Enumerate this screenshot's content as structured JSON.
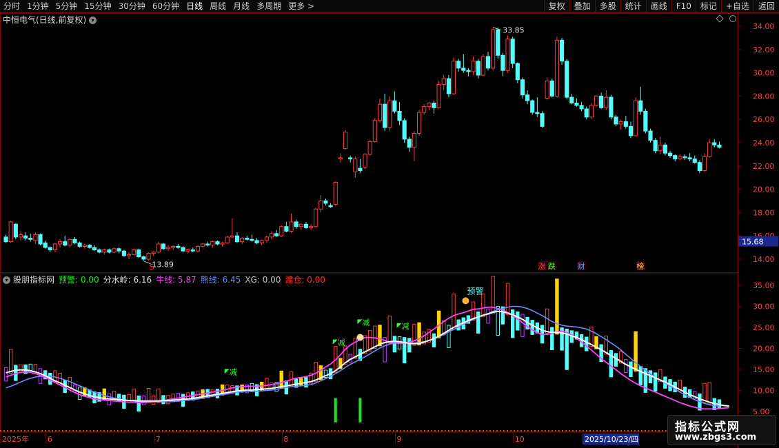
{
  "toolbar": {
    "periods": [
      "分时",
      "1分钟",
      "5分钟",
      "15分钟",
      "30分钟",
      "60分钟",
      "日线",
      "周线",
      "月线",
      "多周期"
    ],
    "active_period": "日线",
    "more": "更多 >",
    "right_buttons": [
      "复权",
      "叠加",
      "多股",
      "统计",
      "画线",
      "F10",
      "标记",
      "+自选",
      "返回"
    ]
  },
  "main_panel": {
    "stock_title": "中恒电气(日线,前复权)",
    "y_ticks": [
      "34.00",
      "32.00",
      "30.00",
      "28.00",
      "26.00",
      "24.00",
      "22.00",
      "20.00",
      "18.00",
      "16.00",
      "14.00"
    ],
    "current_price": "15.68",
    "high_annotation": "33.85",
    "low_annotation": "13.89",
    "event_tags": [
      {
        "text": "S",
        "color": "#ff3030",
        "bar": 30
      },
      {
        "text": "涨",
        "color": "#ff4040",
        "bar": 109
      },
      {
        "text": "跌",
        "color": "#30ff30",
        "bar": 111
      },
      {
        "text": "财",
        "color": "#4aa0ff",
        "bar": 117
      },
      {
        "text": "榜",
        "color": "#ffd040",
        "bar": 129
      }
    ]
  },
  "indicator_panel": {
    "name": "股朋指标网",
    "items": [
      {
        "label": "预警: 0.00",
        "color": "#00ff00"
      },
      {
        "label": "分水岭: 6.16",
        "color": "#e0e0e0"
      },
      {
        "label": "牛线: 5.87",
        "color": "#ff40ff"
      },
      {
        "label": "熊线: 6.45",
        "color": "#6a8cff"
      },
      {
        "label": "XG: 0.00",
        "color": "#c8c8c8"
      },
      {
        "label": "建仓: 0.00",
        "color": "#ff3030"
      }
    ],
    "y_ticks": [
      "35.00",
      "30.00",
      "25.00",
      "20.00",
      "15.00",
      "10.00",
      "5.00"
    ],
    "signal_labels": [
      {
        "text": "减",
        "bar": 45
      },
      {
        "text": "减",
        "bar": 67
      },
      {
        "text": "减",
        "bar": 72
      },
      {
        "text": "减",
        "bar": 80
      }
    ],
    "warning_label": "预警"
  },
  "time_axis": {
    "labels": [
      {
        "text": "2025年",
        "bar": 0
      },
      {
        "text": "6",
        "bar": 9
      },
      {
        "text": "7",
        "bar": 31
      },
      {
        "text": "8",
        "bar": 57
      },
      {
        "text": "9",
        "bar": 80
      },
      {
        "text": "10",
        "bar": 104
      }
    ],
    "cursor_date": "2025/10/23/四"
  },
  "colors": {
    "up": "#ff3b3b",
    "down": "#54fcfc",
    "frame": "#8b0000",
    "ma_white": "#ffffff",
    "bull_line": "#ff40ff",
    "bear_line": "#6a8cff"
  },
  "watermark": {
    "title": "指标公式网",
    "url": "www.zbgs3.com"
  },
  "chart_data": {
    "type": "candlestick",
    "ylim": [
      13.0,
      35.0
    ],
    "ohlc": [
      [
        15.9,
        16.1,
        15.4,
        15.5
      ],
      [
        15.5,
        17.3,
        15.4,
        17.2
      ],
      [
        17.0,
        17.1,
        15.7,
        15.9
      ],
      [
        15.9,
        16.4,
        15.6,
        16.1
      ],
      [
        16.0,
        16.3,
        15.6,
        15.8
      ],
      [
        15.8,
        16.2,
        15.5,
        15.7
      ],
      [
        15.6,
        16.3,
        15.3,
        16.1
      ],
      [
        16.1,
        16.2,
        15.2,
        15.3
      ],
      [
        15.4,
        15.6,
        14.9,
        15.0
      ],
      [
        15.0,
        15.1,
        14.6,
        14.8
      ],
      [
        14.8,
        15.4,
        14.6,
        15.3
      ],
      [
        15.3,
        15.7,
        15.0,
        15.5
      ],
      [
        15.5,
        16.0,
        15.1,
        15.2
      ],
      [
        15.2,
        15.8,
        15.0,
        15.7
      ],
      [
        15.7,
        15.9,
        15.3,
        15.4
      ],
      [
        15.4,
        15.5,
        15.0,
        15.1
      ],
      [
        15.1,
        15.3,
        14.9,
        15.2
      ],
      [
        15.2,
        15.3,
        14.9,
        15.0
      ],
      [
        15.0,
        15.2,
        14.7,
        14.8
      ],
      [
        14.8,
        14.9,
        14.5,
        14.6
      ],
      [
        14.6,
        14.9,
        14.4,
        14.8
      ],
      [
        14.8,
        14.9,
        14.5,
        14.6
      ],
      [
        14.6,
        15.0,
        14.5,
        14.9
      ],
      [
        14.9,
        15.0,
        14.5,
        14.7
      ],
      [
        14.7,
        14.8,
        14.2,
        14.3
      ],
      [
        14.3,
        14.6,
        14.0,
        14.4
      ],
      [
        14.4,
        14.9,
        14.3,
        14.8
      ],
      [
        14.8,
        14.9,
        14.1,
        14.2
      ],
      [
        14.2,
        14.3,
        13.9,
        14.0
      ],
      [
        14.0,
        14.6,
        13.9,
        14.5
      ],
      [
        14.5,
        14.7,
        14.3,
        14.6
      ],
      [
        14.6,
        15.5,
        14.5,
        15.3
      ],
      [
        15.3,
        15.4,
        14.8,
        14.9
      ],
      [
        14.9,
        15.2,
        14.7,
        15.0
      ],
      [
        15.0,
        15.2,
        14.8,
        15.1
      ],
      [
        15.1,
        15.3,
        14.9,
        15.0
      ],
      [
        15.0,
        15.1,
        14.6,
        14.7
      ],
      [
        14.7,
        14.9,
        14.5,
        14.8
      ],
      [
        14.8,
        15.0,
        14.6,
        14.7
      ],
      [
        14.7,
        15.2,
        14.6,
        15.1
      ],
      [
        15.1,
        15.4,
        15.0,
        15.3
      ],
      [
        15.3,
        15.5,
        15.1,
        15.2
      ],
      [
        15.2,
        15.6,
        15.0,
        15.5
      ],
      [
        15.5,
        15.6,
        15.2,
        15.3
      ],
      [
        15.3,
        15.5,
        15.1,
        15.4
      ],
      [
        15.4,
        16.0,
        15.3,
        15.9
      ],
      [
        15.9,
        17.5,
        15.8,
        16.0
      ],
      [
        16.0,
        16.3,
        15.4,
        15.5
      ],
      [
        15.5,
        15.9,
        15.3,
        15.8
      ],
      [
        15.8,
        16.0,
        15.6,
        15.7
      ],
      [
        15.7,
        16.1,
        15.5,
        15.6
      ],
      [
        15.6,
        15.8,
        15.3,
        15.4
      ],
      [
        15.4,
        15.7,
        15.2,
        15.6
      ],
      [
        15.6,
        16.0,
        15.4,
        15.9
      ],
      [
        15.9,
        16.4,
        15.7,
        16.2
      ],
      [
        16.2,
        16.5,
        15.9,
        16.0
      ],
      [
        16.0,
        16.9,
        15.9,
        16.8
      ],
      [
        16.8,
        17.2,
        16.3,
        16.4
      ],
      [
        16.4,
        17.9,
        16.3,
        17.2
      ],
      [
        17.2,
        17.4,
        16.6,
        16.8
      ],
      [
        16.8,
        17.1,
        16.5,
        17.0
      ],
      [
        17.0,
        17.2,
        16.6,
        16.7
      ],
      [
        16.7,
        17.0,
        16.5,
        16.8
      ],
      [
        16.8,
        18.4,
        16.7,
        18.3
      ],
      [
        18.3,
        19.5,
        18.0,
        19.0
      ],
      [
        19.0,
        19.2,
        18.6,
        18.8
      ],
      [
        18.6,
        18.8,
        18.4,
        18.5
      ],
      [
        18.7,
        20.7,
        18.6,
        20.6
      ],
      [
        22.6,
        23.1,
        22.3,
        22.7
      ],
      [
        23.5,
        25.1,
        23.4,
        24.9
      ],
      [
        22.7,
        22.9,
        22.3,
        22.6
      ],
      [
        21.5,
        22.8,
        21.0,
        22.6
      ],
      [
        21.8,
        22.6,
        21.4,
        21.6
      ],
      [
        21.9,
        23.1,
        21.7,
        23.0
      ],
      [
        23.0,
        24.2,
        22.9,
        24.1
      ],
      [
        24.1,
        26.1,
        24.0,
        25.9
      ],
      [
        25.9,
        27.8,
        25.7,
        27.3
      ],
      [
        27.3,
        28.2,
        25.0,
        25.3
      ],
      [
        25.3,
        28.0,
        25.0,
        27.6
      ],
      [
        27.6,
        28.4,
        26.5,
        26.7
      ],
      [
        26.7,
        27.5,
        25.5,
        25.9
      ],
      [
        25.9,
        26.1,
        24.0,
        24.3
      ],
      [
        24.3,
        24.5,
        23.2,
        23.6
      ],
      [
        23.6,
        25.0,
        22.4,
        24.8
      ],
      [
        24.8,
        26.8,
        24.6,
        26.6
      ],
      [
        26.6,
        27.3,
        26.4,
        27.1
      ],
      [
        27.1,
        27.5,
        26.8,
        27.4
      ],
      [
        27.4,
        27.6,
        26.5,
        27.0
      ],
      [
        27.0,
        29.3,
        26.9,
        29.0
      ],
      [
        29.0,
        29.8,
        28.5,
        29.5
      ],
      [
        29.5,
        29.8,
        27.9,
        28.2
      ],
      [
        28.2,
        31.3,
        28.1,
        31.0
      ],
      [
        31.0,
        31.2,
        30.1,
        30.4
      ],
      [
        30.4,
        31.6,
        30.0,
        30.2
      ],
      [
        30.2,
        30.4,
        29.7,
        30.1
      ],
      [
        30.1,
        31.4,
        29.8,
        31.0
      ],
      [
        31.0,
        31.2,
        29.5,
        29.8
      ],
      [
        29.8,
        31.6,
        29.7,
        31.4
      ],
      [
        31.4,
        31.8,
        30.2,
        30.4
      ],
      [
        30.4,
        33.9,
        30.2,
        33.7
      ],
      [
        33.7,
        33.9,
        31.2,
        31.5
      ],
      [
        31.5,
        31.7,
        29.7,
        30.2
      ],
      [
        30.2,
        33.2,
        30.0,
        32.9
      ],
      [
        32.9,
        33.1,
        30.4,
        30.8
      ],
      [
        30.8,
        30.9,
        29.1,
        29.4
      ],
      [
        29.4,
        29.6,
        27.8,
        28.1
      ],
      [
        28.1,
        28.5,
        27.3,
        27.6
      ],
      [
        27.6,
        27.7,
        26.4,
        26.6
      ],
      [
        26.6,
        27.9,
        26.2,
        26.5
      ],
      [
        26.5,
        26.7,
        25.3,
        25.4
      ],
      [
        27.8,
        29.6,
        27.7,
        29.3
      ],
      [
        29.3,
        29.5,
        27.9,
        28.0
      ],
      [
        28.0,
        33.1,
        27.9,
        32.8
      ],
      [
        32.8,
        33.0,
        30.7,
        31.0
      ],
      [
        31.0,
        31.2,
        27.7,
        27.9
      ],
      [
        27.9,
        28.2,
        27.3,
        27.4
      ],
      [
        27.4,
        27.8,
        27.1,
        27.2
      ],
      [
        27.2,
        27.5,
        26.7,
        26.9
      ],
      [
        26.9,
        27.1,
        26.0,
        26.2
      ],
      [
        26.2,
        27.4,
        26.0,
        27.2
      ],
      [
        27.2,
        28.1,
        27.1,
        28.0
      ],
      [
        28.0,
        28.3,
        26.9,
        27.0
      ],
      [
        27.0,
        28.5,
        26.8,
        27.9
      ],
      [
        27.9,
        28.1,
        26.0,
        26.2
      ],
      [
        26.2,
        26.4,
        25.4,
        25.6
      ],
      [
        25.6,
        26.0,
        25.1,
        25.8
      ],
      [
        25.8,
        26.3,
        25.2,
        25.4
      ],
      [
        25.4,
        25.8,
        24.4,
        24.6
      ],
      [
        24.6,
        27.9,
        24.5,
        27.6
      ],
      [
        27.6,
        28.8,
        26.4,
        26.7
      ],
      [
        26.7,
        26.9,
        24.8,
        25.0
      ],
      [
        25.0,
        25.2,
        24.0,
        24.2
      ],
      [
        24.2,
        24.4,
        23.1,
        23.3
      ],
      [
        23.3,
        24.5,
        23.0,
        23.8
      ],
      [
        23.8,
        24.0,
        22.9,
        23.1
      ],
      [
        23.1,
        23.3,
        22.7,
        22.9
      ],
      [
        22.9,
        23.0,
        22.4,
        22.6
      ],
      [
        22.6,
        23.0,
        22.5,
        22.8
      ],
      [
        22.8,
        23.0,
        22.5,
        22.7
      ],
      [
        22.7,
        23.1,
        22.4,
        22.6
      ],
      [
        22.6,
        22.9,
        22.2,
        22.3
      ],
      [
        22.3,
        22.5,
        21.4,
        21.6
      ],
      [
        21.6,
        23.1,
        21.5,
        22.8
      ],
      [
        22.8,
        24.3,
        22.7,
        24.0
      ],
      [
        24.0,
        24.3,
        23.6,
        23.8
      ],
      [
        23.8,
        24.1,
        23.5,
        23.6
      ]
    ],
    "indicator": {
      "ylim": [
        2.0,
        37.0
      ],
      "white_line": [
        14.2,
        14.5,
        14.8,
        14.9,
        14.9,
        14.7,
        14.4,
        14.0,
        13.5,
        12.9,
        12.3,
        11.8,
        11.2,
        10.7,
        10.1,
        9.6,
        9.2,
        8.8,
        8.5,
        8.3,
        8.1,
        8.0,
        7.9,
        7.8,
        7.7,
        7.6,
        7.6,
        7.5,
        7.5,
        7.5,
        7.5,
        7.5,
        7.6,
        7.6,
        7.7,
        7.8,
        7.9,
        8.0,
        8.1,
        8.3,
        8.5,
        8.7,
        8.9,
        9.1,
        9.3,
        9.5,
        9.7,
        9.9,
        10.0,
        10.1,
        10.1,
        10.2,
        10.3,
        10.4,
        10.5,
        10.7,
        10.9,
        11.1,
        11.3,
        11.5,
        11.7,
        11.9,
        12.1,
        12.5,
        13.0,
        13.5,
        14.0,
        14.7,
        15.6,
        16.6,
        17.4,
        18.0,
        18.6,
        19.2,
        19.8,
        20.4,
        21.0,
        21.4,
        21.6,
        21.7,
        21.6,
        21.4,
        21.2,
        21.1,
        21.2,
        21.5,
        21.9,
        22.3,
        22.9,
        23.6,
        24.3,
        25.0,
        25.6,
        26.1,
        26.6,
        27.1,
        27.5,
        27.9,
        28.2,
        28.6,
        28.8,
        28.7,
        28.4,
        28.0,
        27.5,
        26.9,
        26.2,
        25.5,
        24.9,
        24.3,
        24.0,
        23.8,
        23.8,
        23.7,
        23.4,
        23.0,
        22.6,
        22.1,
        21.5,
        20.9,
        20.3,
        19.7,
        19.0,
        18.3,
        17.6,
        16.9,
        16.2,
        15.6,
        15.0,
        14.5,
        14.0,
        13.5,
        13.0,
        12.5,
        12.0,
        11.4,
        10.8,
        10.2,
        9.6,
        9.0,
        8.5,
        8.0,
        7.6,
        7.2,
        6.9,
        6.6,
        6.4,
        6.3
      ],
      "bull_line": [
        13.2,
        13.6,
        14.0,
        14.3,
        14.4,
        14.3,
        14.0,
        13.6,
        13.1,
        12.5,
        11.9,
        11.3,
        10.7,
        10.1,
        9.5,
        9.0,
        8.6,
        8.3,
        8.0,
        7.8,
        7.7,
        7.6,
        7.5,
        7.4,
        7.3,
        7.2,
        7.2,
        7.1,
        7.1,
        7.2,
        7.3,
        7.4,
        7.6,
        7.8,
        8.0,
        8.2,
        8.4,
        8.6,
        8.8,
        9.0,
        9.2,
        9.4,
        9.6,
        9.8,
        10.0,
        10.3,
        10.6,
        10.8,
        10.9,
        11.0,
        11.0,
        11.0,
        11.1,
        11.2,
        11.4,
        11.6,
        11.9,
        12.2,
        12.6,
        12.9,
        13.1,
        13.3,
        13.6,
        14.1,
        14.8,
        15.6,
        16.3,
        17.3,
        18.5,
        19.8,
        20.8,
        21.5,
        22.1,
        22.6,
        22.6,
        22.5,
        22.3,
        21.9,
        21.5,
        21.3,
        21.2,
        21.3,
        21.5,
        21.8,
        22.3,
        23.0,
        23.8,
        24.6,
        25.5,
        26.4,
        27.2,
        27.8,
        28.2,
        28.5,
        28.9,
        29.3,
        29.4,
        29.6,
        29.8,
        29.8,
        29.5,
        29.1,
        28.5,
        27.8,
        27.0,
        26.1,
        25.2,
        24.4,
        23.8,
        23.3,
        23.3,
        23.6,
        24.0,
        24.1,
        23.8,
        23.2,
        22.4,
        21.5,
        20.6,
        19.6,
        18.6,
        17.6,
        16.7,
        15.8,
        14.9,
        14.0,
        13.2,
        12.4,
        11.7,
        11.1,
        10.6,
        10.1,
        9.6,
        9.1,
        8.6,
        8.1,
        7.6,
        7.1,
        6.7,
        6.3,
        6.0,
        5.7,
        5.6,
        5.6,
        5.6,
        5.7,
        5.8,
        5.9
      ],
      "bear_line": [
        10.6,
        11.0,
        11.5,
        12.0,
        12.5,
        12.9,
        13.2,
        13.4,
        13.5,
        13.4,
        13.2,
        12.9,
        12.5,
        12.1,
        11.6,
        11.1,
        10.6,
        10.1,
        9.6,
        9.2,
        8.8,
        8.5,
        8.2,
        8.0,
        7.8,
        7.6,
        7.5,
        7.4,
        7.3,
        7.3,
        7.3,
        7.3,
        7.3,
        7.3,
        7.4,
        7.5,
        7.6,
        7.7,
        7.8,
        8.0,
        8.2,
        8.4,
        8.6,
        8.8,
        9.0,
        9.2,
        9.4,
        9.6,
        9.7,
        9.8,
        9.8,
        9.8,
        9.9,
        10.0,
        10.1,
        10.3,
        10.5,
        10.7,
        10.9,
        11.0,
        11.1,
        11.2,
        11.4,
        11.8,
        12.3,
        12.8,
        13.4,
        14.0,
        14.7,
        15.5,
        16.2,
        16.8,
        17.4,
        18.0,
        18.7,
        19.4,
        20.1,
        20.6,
        21.0,
        21.3,
        21.4,
        21.4,
        21.3,
        21.3,
        21.4,
        21.6,
        21.9,
        22.3,
        22.7,
        23.3,
        23.9,
        24.5,
        25.1,
        25.7,
        26.3,
        26.9,
        27.4,
        27.9,
        28.3,
        28.8,
        29.2,
        29.5,
        29.8,
        30.0,
        30.0,
        29.8,
        29.5,
        29.0,
        28.4,
        27.8,
        27.1,
        26.4,
        25.9,
        25.5,
        25.3,
        25.2,
        25.1,
        24.9,
        24.6,
        24.1,
        23.5,
        22.8,
        22.1,
        21.3,
        20.5,
        19.6,
        18.6,
        17.6,
        16.6,
        15.7,
        14.8,
        13.9,
        13.1,
        12.4,
        11.7,
        11.0,
        10.3,
        9.6,
        9.0,
        8.4,
        7.8,
        7.3,
        6.9,
        6.6,
        6.4,
        6.3
      ]
    }
  }
}
